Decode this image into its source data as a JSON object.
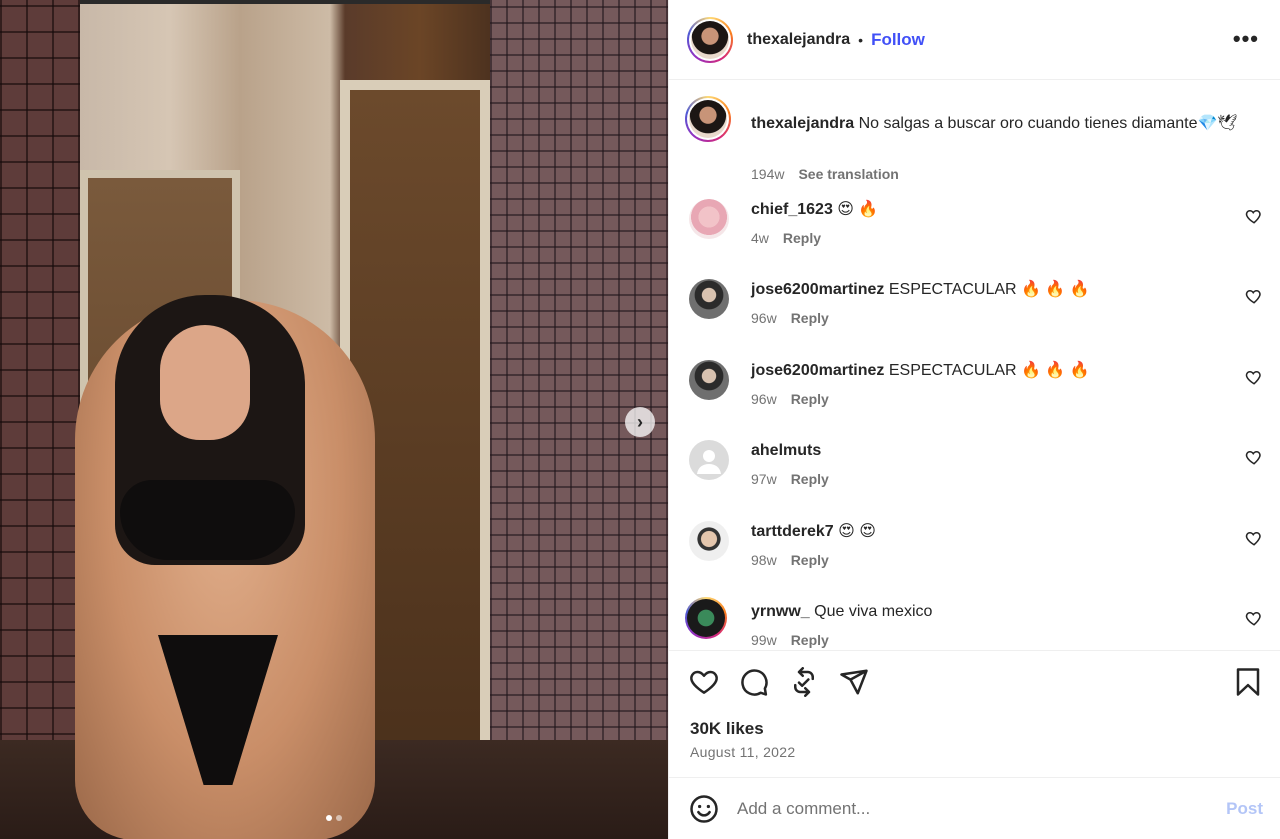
{
  "post": {
    "username": "thexalejandra",
    "separator": "•",
    "follow_label": "Follow",
    "more_label": "•••"
  },
  "caption": {
    "username": "thexalejandra",
    "text": "No salgas a buscar oro cuando tienes diamante💎🕊",
    "age": "194w",
    "see_translation": "See translation"
  },
  "comments": [
    {
      "username": "chief_1623",
      "text": "😍 🔥",
      "age": "4w",
      "reply": "Reply"
    },
    {
      "username": "jose6200martinez",
      "text": "ESPECTACULAR 🔥 🔥 🔥",
      "age": "96w",
      "reply": "Reply"
    },
    {
      "username": "jose6200martinez",
      "text": "ESPECTACULAR 🔥 🔥 🔥",
      "age": "96w",
      "reply": "Reply"
    },
    {
      "username": "ahelmuts",
      "text": "",
      "age": "97w",
      "reply": "Reply"
    },
    {
      "username": "tarttderek7",
      "text": "😍 😍",
      "age": "98w",
      "reply": "Reply"
    },
    {
      "username": "yrnww_",
      "text": "Que viva mexico",
      "age": "99w",
      "reply": "Reply"
    }
  ],
  "media": {
    "next_label": "›",
    "slide_count": 2,
    "active_slide": 1
  },
  "actions": {
    "icons": [
      "heart-icon",
      "comment-icon",
      "repost-icon",
      "share-icon",
      "bookmark-icon"
    ],
    "likes": "30K likes",
    "date": "August 11, 2022"
  },
  "add_comment": {
    "placeholder": "Add a comment...",
    "post_label": "Post"
  },
  "colors": {
    "follow": "#4150f7",
    "post_disabled": "#b3c5f7",
    "muted": "#737373"
  }
}
